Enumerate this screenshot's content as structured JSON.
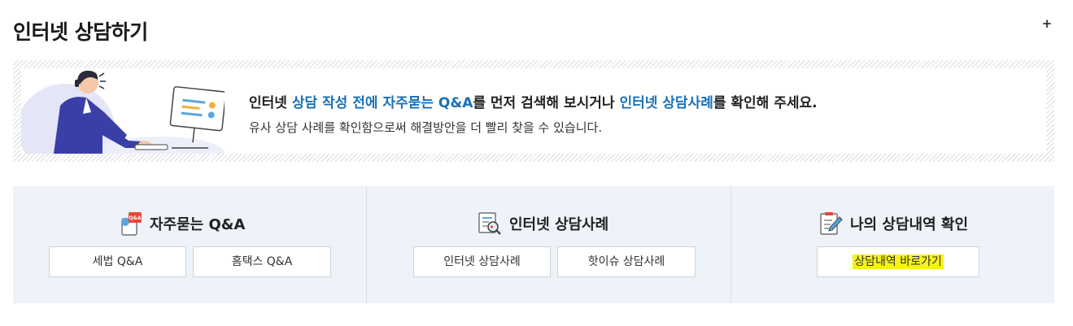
{
  "header": {
    "title": "인터넷 상담하기",
    "more_label": "+"
  },
  "banner": {
    "line1": {
      "part1": "인터넷 ",
      "link1": "상담 작성 전에 자주묻는 Q&A",
      "part2": "를 먼저 검색해 보시거나 ",
      "link2": "인터넷 상담사례",
      "part3": "를 확인해 주세요."
    },
    "line2": "유사 상담 사례를 확인함으로써 해결방안을 더 빨리 찾을 수 있습니다."
  },
  "sections": {
    "faq": {
      "title": "자주묻는 Q&A",
      "icon": "qa-card-icon",
      "buttons": [
        "세법 Q&A",
        "홈택스 Q&A"
      ]
    },
    "cases": {
      "title": "인터넷 상담사례",
      "icon": "document-search-icon",
      "buttons": [
        "인터넷 상담사례",
        "핫이슈 상담사례"
      ]
    },
    "history": {
      "title": "나의 상담내역 확인",
      "icon": "notepad-pen-icon",
      "button": "상담내역 바로가기"
    }
  },
  "colors": {
    "accent": "#1870b8",
    "panel_bg": "#eef2f9",
    "highlight": "#f4f21a"
  }
}
